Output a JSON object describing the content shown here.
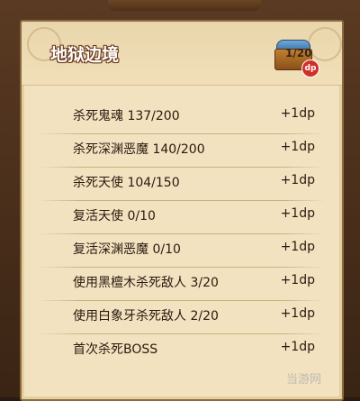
{
  "panel": {
    "title": "地狱边境",
    "progress": "1/20",
    "dp_badge": "dp"
  },
  "tasks": [
    {
      "name": "杀死鬼魂 137/200",
      "reward": "+1dp"
    },
    {
      "name": "杀死深渊恶魔 140/200",
      "reward": "+1dp"
    },
    {
      "name": "杀死天使 104/150",
      "reward": "+1dp"
    },
    {
      "name": "复活天使 0/10",
      "reward": "+1dp"
    },
    {
      "name": "复活深渊恶魔 0/10",
      "reward": "+1dp"
    },
    {
      "name": "使用黑檀木杀死敌人 3/20",
      "reward": "+1dp"
    },
    {
      "name": "使用白象牙杀死敌人 2/20",
      "reward": "+1dp"
    },
    {
      "name": "首次杀死BOSS",
      "reward": "+1dp"
    }
  ],
  "watermark": "当游网",
  "colors": {
    "parchment": "#f2e2bf",
    "frame": "#5a3a22",
    "badge": "#d0302a"
  }
}
